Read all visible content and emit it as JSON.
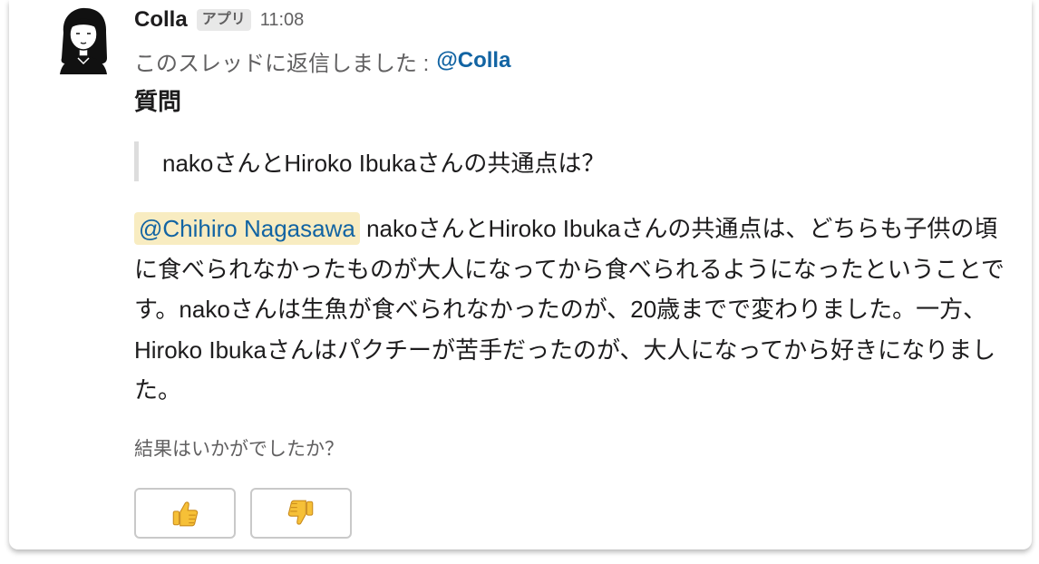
{
  "message": {
    "sender": "Colla",
    "app_badge": "アプリ",
    "time": "11:08",
    "reply_prefix": "このスレッドに返信しました :",
    "reply_mention": "@Colla",
    "question_title": "質問",
    "quote": "nakoさんとHiroko Ibukaさんの共通点は？",
    "answer_mention": "@Chihiro Nagasawa",
    "answer_text": " nakoさんとHiroko Ibukaさんの共通点は、どちらも子供の頃に食べられなかったものが大人になってから食べられるようになったということです。nakoさんは生魚が食べられなかったのが、20歳までで変わりました。一方、Hiroko Ibukaさんはパクチーが苦手だったのが、大人になってから好きになりました。",
    "followup": "結果はいかがでしたか？"
  },
  "actions": {
    "thumbs_up_icon": "thumbs-up-icon",
    "thumbs_down_icon": "thumbs-down-icon"
  },
  "colors": {
    "link": "#1264a3",
    "mention_bg": "#f8ecc1",
    "muted_text": "#616061",
    "emoji_yellow": "#f6c037"
  }
}
